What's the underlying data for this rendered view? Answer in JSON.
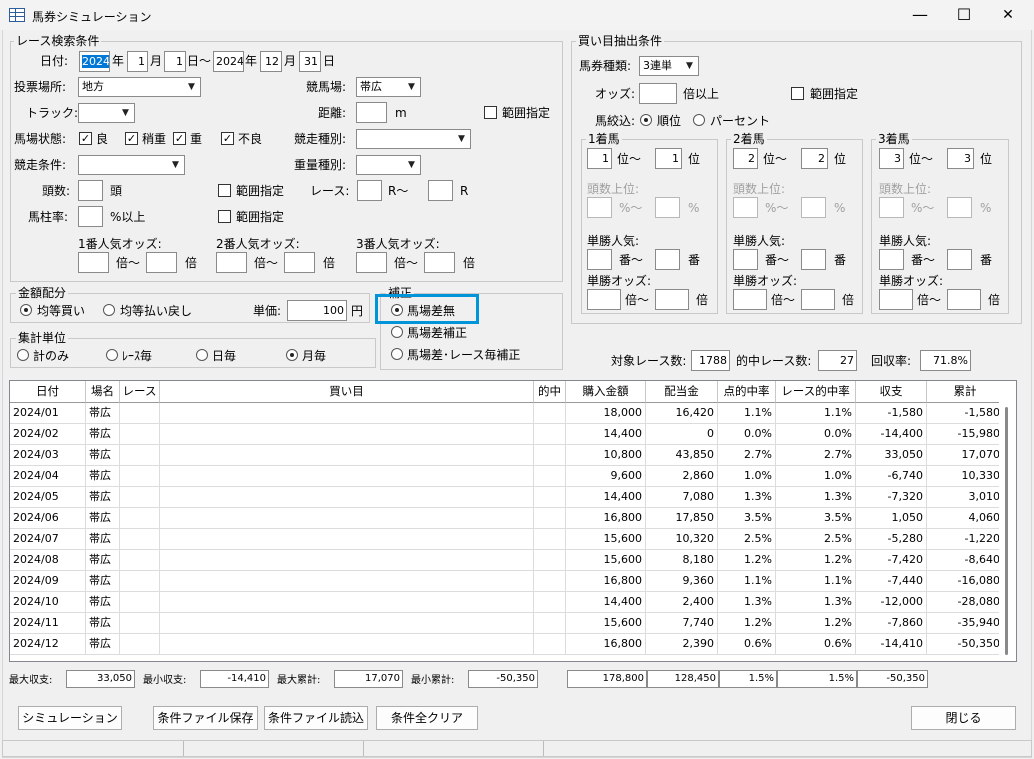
{
  "window": {
    "title": "馬券シミュレーション",
    "minimize": "—",
    "maximize": "☐",
    "close": "✕"
  },
  "search": {
    "group_label": "レース検索条件",
    "date_label": "日付:",
    "from_year": "2024",
    "from_month": "1",
    "from_day": "1",
    "to_year": "2024",
    "to_month": "12",
    "to_day": "31",
    "year_suffix": "年",
    "month_suffix": "月",
    "day_tilde": "日〜",
    "day_suffix": "日",
    "venue_label": "投票場所:",
    "venue_value": "地方",
    "course_label": "競馬場:",
    "course_value": "帯広",
    "track_label": "トラック:",
    "track_value": "",
    "distance_label": "距離:",
    "distance_value": "",
    "distance_unit": "m",
    "range_label": "範囲指定",
    "condition_label": "馬場状態:",
    "conditions": [
      {
        "label": "良",
        "checked": true
      },
      {
        "label": "稍重",
        "checked": true
      },
      {
        "label": "重",
        "checked": true
      },
      {
        "label": "不良",
        "checked": true
      }
    ],
    "racetype_label": "競走種別:",
    "racetype_value": "",
    "racecond_label": "競走条件:",
    "racecond_value": "",
    "weight_label": "重量種別:",
    "weight_value": "",
    "heads_label": "頭数:",
    "heads_value": "",
    "heads_unit": "頭",
    "race_label": "レース:",
    "race_from": "",
    "race_mid": "R〜",
    "race_to": "",
    "race_unit": "R",
    "post_label": "馬柱率:",
    "post_value": "",
    "post_unit": "%以上",
    "odds1_label": "1番人気オッズ:",
    "odds2_label": "2番人気オッズ:",
    "odds3_label": "3番人気オッズ:",
    "odds_mid": "倍〜",
    "odds_unit": "倍"
  },
  "bet": {
    "group_label": "買い目抽出条件",
    "type_label": "馬券種類:",
    "type_value": "3連単",
    "odds_label": "オッズ:",
    "odds_value": "",
    "odds_unit": "倍以上",
    "range_label": "範囲指定",
    "narrow_label": "馬絞込:",
    "narrow_rank": "順位",
    "narrow_percent": "パーセント",
    "rank_unit": "位",
    "rank_tilde": "位〜",
    "headrank_label": "頭数上位:",
    "pct_mid": "%〜",
    "pct_unit": "%",
    "pop_label": "単勝人気:",
    "pop_mid": "番〜",
    "pop_unit": "番",
    "winodds_label": "単勝オッズ:",
    "winodds_mid": "倍〜",
    "winodds_unit": "倍",
    "horses": [
      {
        "label": "1着馬",
        "from": "1",
        "to": "1"
      },
      {
        "label": "2着馬",
        "from": "2",
        "to": "2"
      },
      {
        "label": "3着馬",
        "from": "3",
        "to": "3"
      }
    ]
  },
  "money": {
    "group_label": "金額配分",
    "equal_buy": "均等買い",
    "equal_return": "均等払い戻し",
    "unit_label": "単価:",
    "unit_value": "100",
    "unit_suffix": "円"
  },
  "correction": {
    "group_label": "補正",
    "none": "馬場差無",
    "track": "馬場差補正",
    "track_race": "馬場差･レース毎補正"
  },
  "aggregate": {
    "group_label": "集計単位",
    "total": "計のみ",
    "per_race": "ﾚｰｽ毎",
    "daily": "日毎",
    "monthly": "月毎"
  },
  "summary": {
    "target_label": "対象レース数:",
    "target_value": "1788",
    "hit_label": "的中レース数:",
    "hit_value": "27",
    "recovery_label": "回収率:",
    "recovery_value": "71.8%"
  },
  "table": {
    "headers": [
      "日付",
      "場名",
      "レース",
      "買い目",
      "的中",
      "購入金額",
      "配当金",
      "点的中率",
      "レース的中率",
      "収支",
      "累計"
    ],
    "rows": [
      [
        "2024/01",
        "帯広",
        "",
        "",
        "",
        "18,000",
        "16,420",
        "1.1%",
        "1.1%",
        "-1,580",
        "-1,580"
      ],
      [
        "2024/02",
        "帯広",
        "",
        "",
        "",
        "14,400",
        "0",
        "0.0%",
        "0.0%",
        "-14,400",
        "-15,980"
      ],
      [
        "2024/03",
        "帯広",
        "",
        "",
        "",
        "10,800",
        "43,850",
        "2.7%",
        "2.7%",
        "33,050",
        "17,070"
      ],
      [
        "2024/04",
        "帯広",
        "",
        "",
        "",
        "9,600",
        "2,860",
        "1.0%",
        "1.0%",
        "-6,740",
        "10,330"
      ],
      [
        "2024/05",
        "帯広",
        "",
        "",
        "",
        "14,400",
        "7,080",
        "1.3%",
        "1.3%",
        "-7,320",
        "3,010"
      ],
      [
        "2024/06",
        "帯広",
        "",
        "",
        "",
        "16,800",
        "17,850",
        "3.5%",
        "3.5%",
        "1,050",
        "4,060"
      ],
      [
        "2024/07",
        "帯広",
        "",
        "",
        "",
        "15,600",
        "10,320",
        "2.5%",
        "2.5%",
        "-5,280",
        "-1,220"
      ],
      [
        "2024/08",
        "帯広",
        "",
        "",
        "",
        "15,600",
        "8,180",
        "1.2%",
        "1.2%",
        "-7,420",
        "-8,640"
      ],
      [
        "2024/09",
        "帯広",
        "",
        "",
        "",
        "16,800",
        "9,360",
        "1.1%",
        "1.1%",
        "-7,440",
        "-16,080"
      ],
      [
        "2024/10",
        "帯広",
        "",
        "",
        "",
        "14,400",
        "2,400",
        "1.3%",
        "1.3%",
        "-12,000",
        "-28,080"
      ],
      [
        "2024/11",
        "帯広",
        "",
        "",
        "",
        "15,600",
        "7,740",
        "1.2%",
        "1.2%",
        "-7,860",
        "-35,940"
      ],
      [
        "2024/12",
        "帯広",
        "",
        "",
        "",
        "16,800",
        "2,390",
        "0.6%",
        "0.6%",
        "-14,410",
        "-50,350"
      ]
    ]
  },
  "totals": {
    "max_income_label": "最大収支:",
    "max_income": "33,050",
    "min_income_label": "最小収支:",
    "min_income": "-14,410",
    "max_cum_label": "最大累計:",
    "max_cum": "17,070",
    "min_cum_label": "最小累計:",
    "min_cum": "-50,350",
    "purchase": "178,800",
    "payout": "128,450",
    "point_rate": "1.5%",
    "race_rate": "1.5%",
    "balance": "-50,350"
  },
  "buttons": {
    "simulate": "シミュレーション",
    "save": "条件ファイル保存",
    "load": "条件ファイル読込",
    "clear": "条件全クリア",
    "close": "閉じる"
  }
}
